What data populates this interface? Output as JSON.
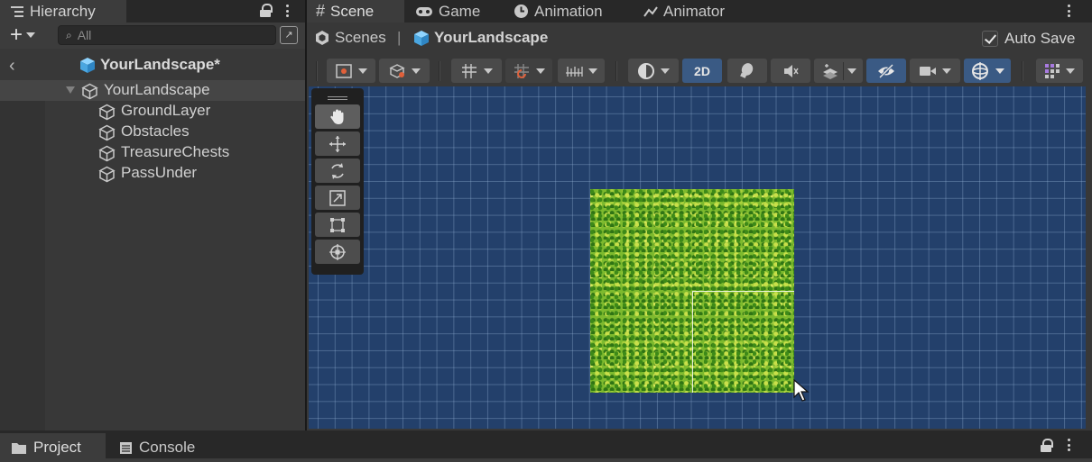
{
  "hierarchy": {
    "tab_label": "Hierarchy",
    "search_placeholder": "All",
    "add_symbol": "+",
    "scene_name": "YourLandscape*",
    "items": [
      {
        "label": "YourLandscape",
        "root": true
      },
      {
        "label": "GroundLayer"
      },
      {
        "label": "Obstacles"
      },
      {
        "label": "TreasureChests"
      },
      {
        "label": "PassUnder"
      }
    ]
  },
  "scene_panel": {
    "tabs": [
      {
        "label": "Scene",
        "icon": "hash-icon",
        "active": true
      },
      {
        "label": "Game",
        "icon": "gamepad-icon"
      },
      {
        "label": "Animation",
        "icon": "clock-icon"
      },
      {
        "label": "Animator",
        "icon": "animator-icon"
      }
    ],
    "breadcrumb": {
      "root": "Scenes",
      "separator": "|",
      "current": "YourLandscape"
    },
    "auto_save": {
      "label": "Auto Save",
      "checked": true
    },
    "toolbar": {
      "mode_2d": "2D"
    }
  },
  "bottom": {
    "tabs": [
      {
        "label": "Project",
        "icon": "folder-icon",
        "active": true
      },
      {
        "label": "Console",
        "icon": "console-icon"
      }
    ]
  },
  "colors": {
    "editor_bg": "#383838",
    "tab_bar_bg": "#282828",
    "viewport_bg": "#23406b",
    "active_toggle": "#3a5a84",
    "prefab_blue": "#5cb8f0",
    "terrain_green": "#7dba2e"
  }
}
